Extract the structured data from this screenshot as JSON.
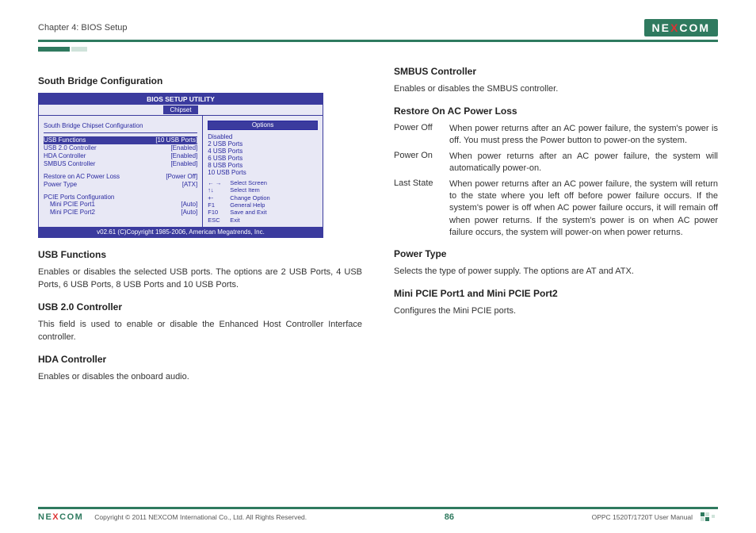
{
  "header": {
    "chapter": "Chapter 4: BIOS Setup",
    "logo": "NEXCOM"
  },
  "bios": {
    "title": "BIOS SETUP UTILITY",
    "tab": "Chipset",
    "section_head": "South Bridge Chipset Configuration",
    "rows": [
      {
        "label": "USB Functions",
        "value": "[10 USB Ports]",
        "highlight": true
      },
      {
        "label": "USB 2.0 Controller",
        "value": "[Enabled]"
      },
      {
        "label": "HDA Controller",
        "value": "[Enabled]"
      },
      {
        "label": "SMBUS Controller",
        "value": "[Enabled]"
      }
    ],
    "rows2": [
      {
        "label": "Restore on AC Power Loss",
        "value": "[Power Off]"
      },
      {
        "label": "Power Type",
        "value": "[ATX]"
      }
    ],
    "pcie_head": "PCIE Ports Configuration",
    "pcie": [
      {
        "label": "Mini PCIE Port1",
        "value": "[Auto]"
      },
      {
        "label": "Mini PCIE Port2",
        "value": "[Auto]"
      }
    ],
    "options_title": "Options",
    "options": [
      "Disabled",
      "2 USB Ports",
      "4 USB Ports",
      "6 USB Ports",
      "8 USB Ports",
      "10 USB Ports"
    ],
    "help": [
      {
        "k": "← →",
        "t": "Select Screen"
      },
      {
        "k": "↑↓",
        "t": "Select Item"
      },
      {
        "k": "+-",
        "t": "Change Option"
      },
      {
        "k": "F1",
        "t": "General Help"
      },
      {
        "k": "F10",
        "t": "Save and Exit"
      },
      {
        "k": "ESC",
        "t": "Exit"
      }
    ],
    "copyright": "v02.61 (C)Copyright 1985-2006, American Megatrends, Inc."
  },
  "left": {
    "title1": "South Bridge Configuration",
    "usb_functions_h": "USB Functions",
    "usb_functions_p": "Enables or disables the selected USB ports. The options are 2 USB Ports, 4 USB Ports, 6 USB Ports, 8 USB Ports and 10 USB Ports.",
    "usb20_h": "USB 2.0 Controller",
    "usb20_p": "This field is used to enable or disable the Enhanced Host Controller Interface controller.",
    "hda_h": "HDA Controller",
    "hda_p": "Enables or disables the onboard audio."
  },
  "right": {
    "smbus_h": "SMBUS Controller",
    "smbus_p": "Enables or disables the SMBUS controller.",
    "restore_h": "Restore On AC Power Loss",
    "restore": [
      {
        "t": "Power Off",
        "d": "When power returns after an AC power failure, the system's power is off. You must press the Power button to power-on the system."
      },
      {
        "t": "Power On",
        "d": "When power returns after an AC power failure, the system will automatically power-on."
      },
      {
        "t": "Last State",
        "d": "When power returns after an AC power failure, the system will return to the state where you left off before power failure occurs. If the system's power is off when AC power failure occurs, it will remain off when power returns. If the system's power is on when AC power failure occurs, the system will power-on when power returns."
      }
    ],
    "ptype_h": "Power Type",
    "ptype_p": "Selects the type of power supply. The options are AT and ATX.",
    "mpcie_h": "Mini PCIE Port1 and Mini PCIE Port2",
    "mpcie_p": "Configures the Mini PCIE ports."
  },
  "footer": {
    "copyright": "Copyright © 2011 NEXCOM International Co., Ltd. All Rights Reserved.",
    "pagenum": "86",
    "manual": "OPPC 1520T/1720T User Manual"
  }
}
